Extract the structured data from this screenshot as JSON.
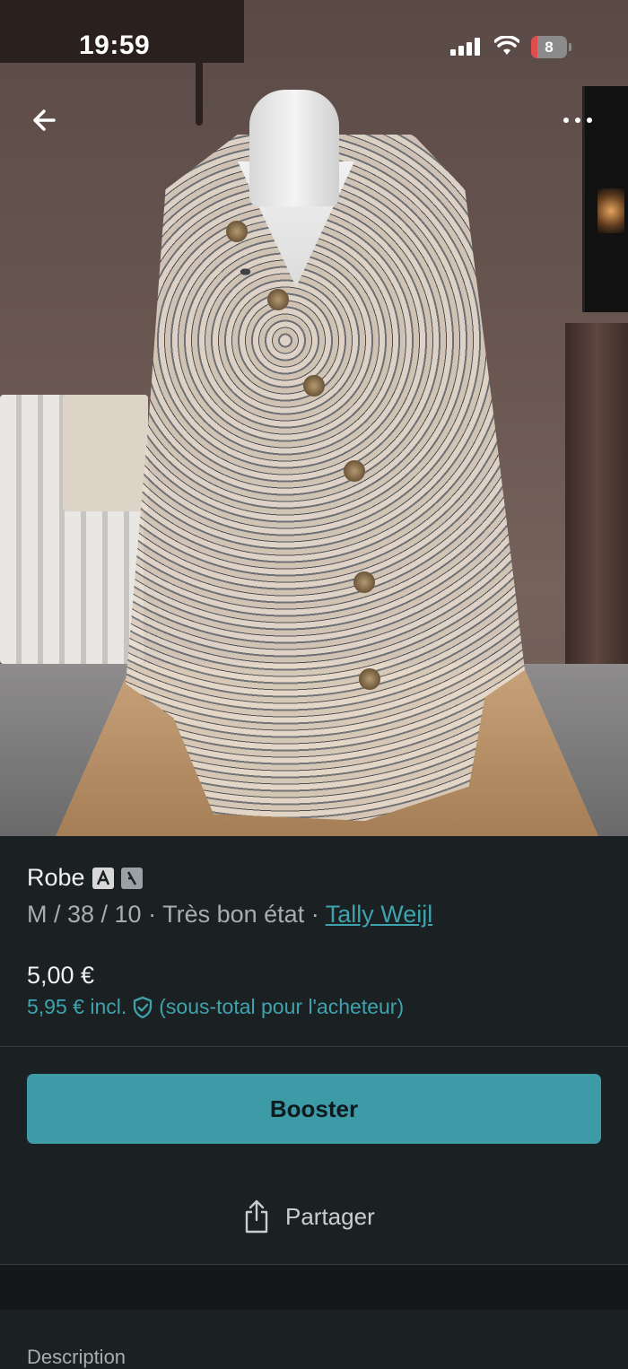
{
  "status_bar": {
    "time": "19:59",
    "battery": "8"
  },
  "item": {
    "title": "Robe",
    "size": "M / 38 / 10",
    "separator": "·",
    "condition": "Très bon état",
    "brand": "Tally Weijl",
    "price": "5,00 €",
    "price_incl_amount": "5,95 € incl.",
    "price_incl_note": "(sous-total pour l'acheteur)"
  },
  "actions": {
    "booster_label": "Booster",
    "share_label": "Partager"
  },
  "section": {
    "description_label": "Description"
  },
  "colors": {
    "accent": "#3d9aa7",
    "link": "#3fa3ad",
    "background": "#1b2022"
  }
}
